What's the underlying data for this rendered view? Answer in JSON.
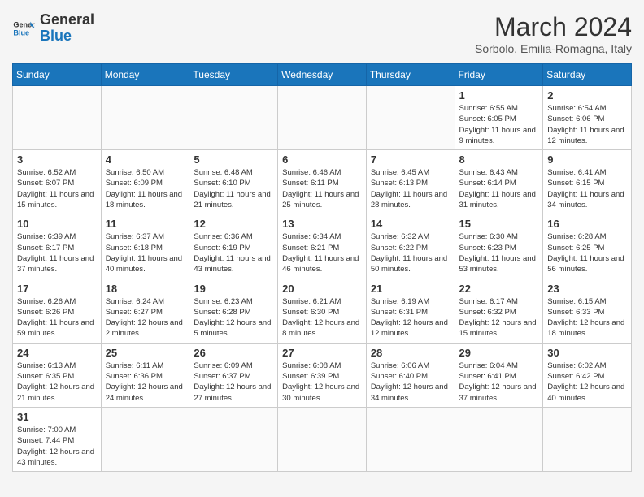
{
  "header": {
    "logo_general": "General",
    "logo_blue": "Blue",
    "month_title": "March 2024",
    "subtitle": "Sorbolo, Emilia-Romagna, Italy"
  },
  "days_of_week": [
    "Sunday",
    "Monday",
    "Tuesday",
    "Wednesday",
    "Thursday",
    "Friday",
    "Saturday"
  ],
  "weeks": [
    [
      {
        "day": "",
        "info": ""
      },
      {
        "day": "",
        "info": ""
      },
      {
        "day": "",
        "info": ""
      },
      {
        "day": "",
        "info": ""
      },
      {
        "day": "",
        "info": ""
      },
      {
        "day": "1",
        "info": "Sunrise: 6:55 AM\nSunset: 6:05 PM\nDaylight: 11 hours and 9 minutes."
      },
      {
        "day": "2",
        "info": "Sunrise: 6:54 AM\nSunset: 6:06 PM\nDaylight: 11 hours and 12 minutes."
      }
    ],
    [
      {
        "day": "3",
        "info": "Sunrise: 6:52 AM\nSunset: 6:07 PM\nDaylight: 11 hours and 15 minutes."
      },
      {
        "day": "4",
        "info": "Sunrise: 6:50 AM\nSunset: 6:09 PM\nDaylight: 11 hours and 18 minutes."
      },
      {
        "day": "5",
        "info": "Sunrise: 6:48 AM\nSunset: 6:10 PM\nDaylight: 11 hours and 21 minutes."
      },
      {
        "day": "6",
        "info": "Sunrise: 6:46 AM\nSunset: 6:11 PM\nDaylight: 11 hours and 25 minutes."
      },
      {
        "day": "7",
        "info": "Sunrise: 6:45 AM\nSunset: 6:13 PM\nDaylight: 11 hours and 28 minutes."
      },
      {
        "day": "8",
        "info": "Sunrise: 6:43 AM\nSunset: 6:14 PM\nDaylight: 11 hours and 31 minutes."
      },
      {
        "day": "9",
        "info": "Sunrise: 6:41 AM\nSunset: 6:15 PM\nDaylight: 11 hours and 34 minutes."
      }
    ],
    [
      {
        "day": "10",
        "info": "Sunrise: 6:39 AM\nSunset: 6:17 PM\nDaylight: 11 hours and 37 minutes."
      },
      {
        "day": "11",
        "info": "Sunrise: 6:37 AM\nSunset: 6:18 PM\nDaylight: 11 hours and 40 minutes."
      },
      {
        "day": "12",
        "info": "Sunrise: 6:36 AM\nSunset: 6:19 PM\nDaylight: 11 hours and 43 minutes."
      },
      {
        "day": "13",
        "info": "Sunrise: 6:34 AM\nSunset: 6:21 PM\nDaylight: 11 hours and 46 minutes."
      },
      {
        "day": "14",
        "info": "Sunrise: 6:32 AM\nSunset: 6:22 PM\nDaylight: 11 hours and 50 minutes."
      },
      {
        "day": "15",
        "info": "Sunrise: 6:30 AM\nSunset: 6:23 PM\nDaylight: 11 hours and 53 minutes."
      },
      {
        "day": "16",
        "info": "Sunrise: 6:28 AM\nSunset: 6:25 PM\nDaylight: 11 hours and 56 minutes."
      }
    ],
    [
      {
        "day": "17",
        "info": "Sunrise: 6:26 AM\nSunset: 6:26 PM\nDaylight: 11 hours and 59 minutes."
      },
      {
        "day": "18",
        "info": "Sunrise: 6:24 AM\nSunset: 6:27 PM\nDaylight: 12 hours and 2 minutes."
      },
      {
        "day": "19",
        "info": "Sunrise: 6:23 AM\nSunset: 6:28 PM\nDaylight: 12 hours and 5 minutes."
      },
      {
        "day": "20",
        "info": "Sunrise: 6:21 AM\nSunset: 6:30 PM\nDaylight: 12 hours and 8 minutes."
      },
      {
        "day": "21",
        "info": "Sunrise: 6:19 AM\nSunset: 6:31 PM\nDaylight: 12 hours and 12 minutes."
      },
      {
        "day": "22",
        "info": "Sunrise: 6:17 AM\nSunset: 6:32 PM\nDaylight: 12 hours and 15 minutes."
      },
      {
        "day": "23",
        "info": "Sunrise: 6:15 AM\nSunset: 6:33 PM\nDaylight: 12 hours and 18 minutes."
      }
    ],
    [
      {
        "day": "24",
        "info": "Sunrise: 6:13 AM\nSunset: 6:35 PM\nDaylight: 12 hours and 21 minutes."
      },
      {
        "day": "25",
        "info": "Sunrise: 6:11 AM\nSunset: 6:36 PM\nDaylight: 12 hours and 24 minutes."
      },
      {
        "day": "26",
        "info": "Sunrise: 6:09 AM\nSunset: 6:37 PM\nDaylight: 12 hours and 27 minutes."
      },
      {
        "day": "27",
        "info": "Sunrise: 6:08 AM\nSunset: 6:39 PM\nDaylight: 12 hours and 30 minutes."
      },
      {
        "day": "28",
        "info": "Sunrise: 6:06 AM\nSunset: 6:40 PM\nDaylight: 12 hours and 34 minutes."
      },
      {
        "day": "29",
        "info": "Sunrise: 6:04 AM\nSunset: 6:41 PM\nDaylight: 12 hours and 37 minutes."
      },
      {
        "day": "30",
        "info": "Sunrise: 6:02 AM\nSunset: 6:42 PM\nDaylight: 12 hours and 40 minutes."
      }
    ],
    [
      {
        "day": "31",
        "info": "Sunrise: 7:00 AM\nSunset: 7:44 PM\nDaylight: 12 hours and 43 minutes."
      },
      {
        "day": "",
        "info": ""
      },
      {
        "day": "",
        "info": ""
      },
      {
        "day": "",
        "info": ""
      },
      {
        "day": "",
        "info": ""
      },
      {
        "day": "",
        "info": ""
      },
      {
        "day": "",
        "info": ""
      }
    ]
  ]
}
